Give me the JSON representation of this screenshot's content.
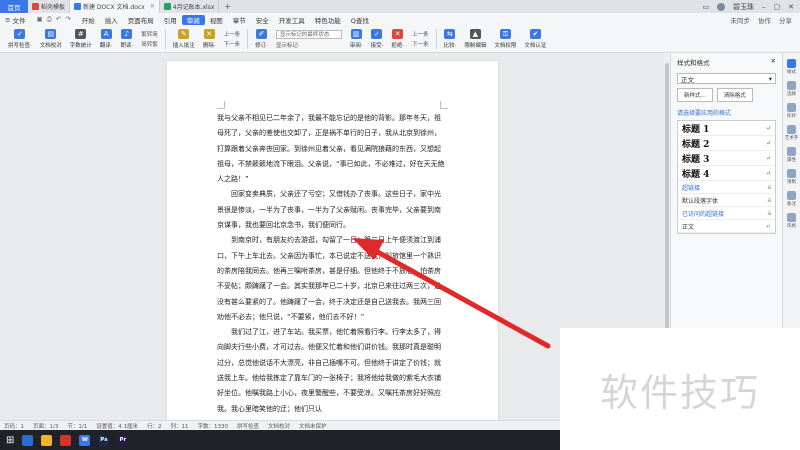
{
  "tabs": {
    "home": "首页",
    "items": [
      {
        "label": "稻壳模板",
        "color": "#e0463b"
      },
      {
        "label": "新建 DOCX 文档.docx",
        "color": "#3b78e7"
      },
      {
        "label": "4月记账本.xlsx",
        "color": "#25a162"
      }
    ],
    "add": "+"
  },
  "window": {
    "user": "碧玉珠"
  },
  "menu": {
    "file": "文件",
    "items": [
      "开始",
      "插入",
      "页面布局",
      "引用",
      "审阅",
      "视图",
      "章节",
      "安全",
      "开发工具",
      "特色功能"
    ],
    "active": "审阅",
    "search": "Q查找",
    "right": [
      "未同步",
      "协作",
      "分享"
    ]
  },
  "ribbon": {
    "buttons": [
      {
        "label": "拼写检查·",
        "color": "#3b78e7"
      },
      {
        "label": "文档校对",
        "color": "#3b78e7"
      },
      {
        "label": "字数统计",
        "color": "#555555"
      },
      {
        "label": "翻译·",
        "color": "#3b78e7"
      },
      {
        "label": "朗读·",
        "color": "#3b78e7"
      }
    ],
    "small1": [
      "繁转简",
      "简转繁"
    ],
    "buttons2": [
      {
        "label": "插入批注",
        "color": "#c9a227"
      },
      {
        "label": "删除·",
        "color": "#c9a227"
      }
    ],
    "small2": [
      "上一条",
      "下一条"
    ],
    "buttons3": [
      {
        "label": "修订·",
        "color": "#3b78e7"
      }
    ],
    "select": "显示标记的最终状态",
    "small3": "显示标记·",
    "buttons4": [
      {
        "label": "审阅·",
        "color": "#3b78e7"
      },
      {
        "label": "接受·",
        "color": "#3b78e7"
      },
      {
        "label": "拒绝·",
        "color": "#e0463b"
      }
    ],
    "small4": [
      "上一条",
      "下一条"
    ],
    "buttons5": [
      {
        "label": "比较·",
        "color": "#3b78e7"
      },
      {
        "label": "限制编辑",
        "color": "#555555"
      },
      {
        "label": "文档权限",
        "color": "#3b78e7"
      },
      {
        "label": "文档认证",
        "color": "#3b78e7"
      }
    ]
  },
  "document": {
    "paragraphs": [
      {
        "indent": false,
        "text": "我与父亲不相见已二年余了，我最不能忘记的是他的背影。那年冬天，祖母死了，父亲的差使也交卸了，正是祸不单行的日子，我从北京到徐州，打算跟着父亲奔丧回家。到徐州见着父亲，看见满院狼藉的东西，又想起祖母，不禁簌簌地流下眼泪。父亲说，“事已如此，不必难过，好在天无绝人之路！”"
      },
      {
        "indent": true,
        "text": "回家变卖典质，父亲还了亏空；又借钱办了丧事。这些日子，家中光景很是惨淡，一半为了丧事，一半为了父亲赋闲。丧事完毕，父亲要到南京谋事，我也要回北京念书，我们便同行。"
      },
      {
        "indent": true,
        "text": "到南京时，有朋友约去游逛，勾留了一日；第二日上午便须渡江到浦口，下午上车北去。父亲因为事忙，本已说定不送我，叫旅馆里一个熟识的茶房陪我同去。他再三嘱咐茶房，甚是仔细。但他终于不放心，怕茶房不妥帖；颇踌躇了一会。其实我那年已二十岁，北京已来往过两三次，是没有甚么要紧的了。他踌躇了一会，终于决定还是自己送我去。我两三回劝他不必去；他只说，“不要紧，他们去不好！”"
      },
      {
        "indent": true,
        "text": "我们过了江，进了车站。我买票，他忙着照看行李。行李太多了，得向脚夫行些小费，才可过去。他便又忙着和他们讲价钱。我那时真是聪明过分，总觉他说话不大漂亮，非自己插嘴不可。但他终于讲定了价钱；就送我上车。他给我拣定了靠车门的一张椅子；我将他给我做的紫毛大衣铺好坐位。他嘱我路上小心，夜里警醒些，不要受凉。又嘱托茶房好好照应我。我心里暗笑他的迂；他们只认"
      }
    ]
  },
  "panel": {
    "title": "样式和格式",
    "current_style": "正文",
    "new_style": "新样式...",
    "clear_format": "清除格式",
    "hint": "请选择要应用的格式",
    "headings": [
      "标题 1",
      "标题 2",
      "标题 3",
      "标题 4"
    ],
    "styles": [
      "超链接",
      "默认段落字体",
      "已访问的超链接",
      "正文"
    ],
    "bottom": "显示：有效样式"
  },
  "rail": [
    "样式",
    "选择",
    "形状",
    "艺术字",
    "属性",
    "限制",
    "备注",
    "风格"
  ],
  "statusbar": [
    "页码：1",
    "页面：1/3",
    "节：1/1",
    "设置值：4.1厘米",
    "行：2",
    "列：11",
    "字数：1330",
    "拼写检查",
    "文档校对",
    "文档未保护"
  ],
  "taskbar": [
    {
      "label": "",
      "color": "#2b6cd6"
    },
    {
      "label": "",
      "color": "#f0b429"
    },
    {
      "label": "",
      "color": "#d8342a"
    },
    {
      "label": "W",
      "color": "#3b78e7"
    },
    {
      "label": "Ps",
      "color": "#1b2a4a"
    },
    {
      "label": "Pr",
      "color": "#2a1a4a"
    }
  ],
  "watermark": "软件技巧",
  "colors": {
    "accent": "#3b78e7",
    "arrow": "#e02a2a"
  }
}
